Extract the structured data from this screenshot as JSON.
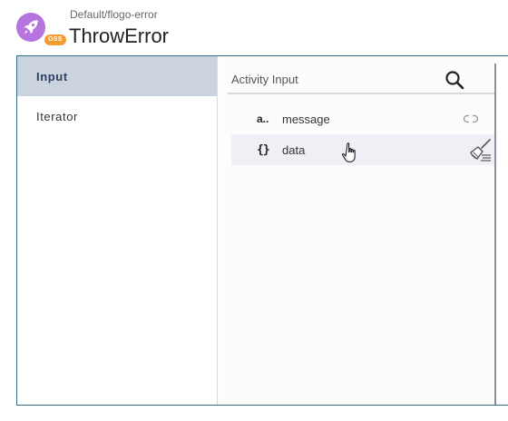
{
  "header": {
    "breadcrumb": "Default/flogo-error",
    "title": "ThrowError",
    "badge": "OSS",
    "app_icon": "rocket-icon",
    "brand_color": "#b574de",
    "badge_color": "#f39c34"
  },
  "sidebar": {
    "items": [
      {
        "label": "Input",
        "active": true
      },
      {
        "label": "Iterator",
        "active": false
      }
    ],
    "active_color": "#cbd3df"
  },
  "content": {
    "search": {
      "placeholder": "Activity Input",
      "value": ""
    },
    "fields": [
      {
        "type_icon": "a..",
        "type": "string",
        "label": "message",
        "action_icon": "link-icon"
      },
      {
        "type_icon": "{}",
        "type": "object",
        "label": "data",
        "action_icon": "clear-mapping-icon",
        "hovered": true
      }
    ]
  }
}
